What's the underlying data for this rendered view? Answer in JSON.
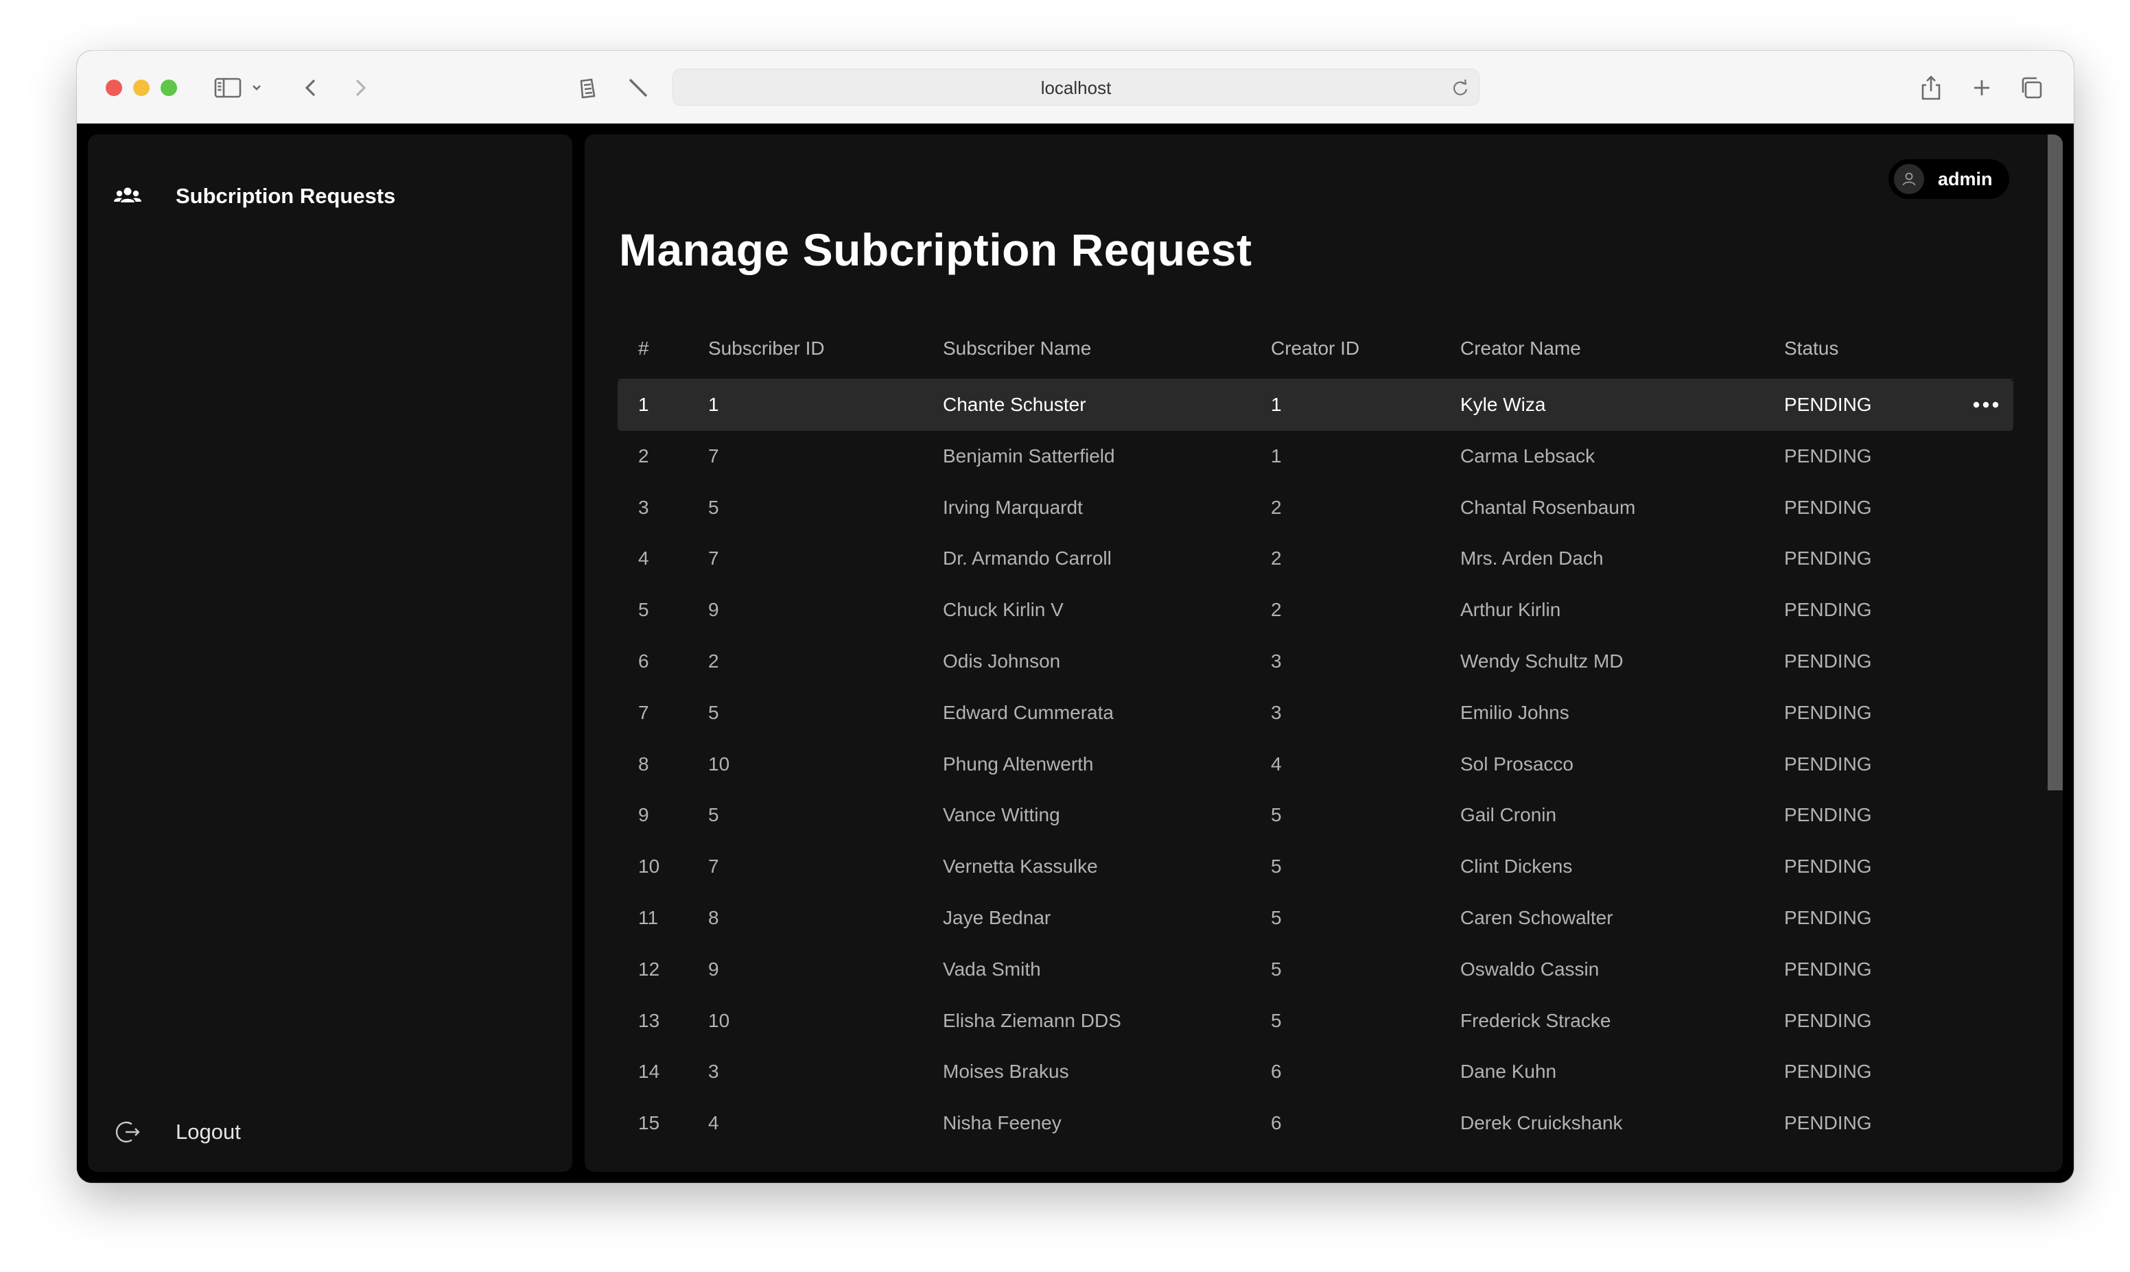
{
  "browser": {
    "url": "localhost"
  },
  "sidebar": {
    "items": [
      {
        "label": "Subcription Requests",
        "icon": "users-icon"
      }
    ],
    "logout_label": "Logout"
  },
  "header": {
    "user_name": "admin"
  },
  "main": {
    "title": "Manage Subcription Request",
    "columns": [
      "#",
      "Subscriber ID",
      "Subscriber Name",
      "Creator ID",
      "Creator Name",
      "Status"
    ],
    "rows": [
      {
        "num": "1",
        "subscriber_id": "1",
        "subscriber_name": "Chante Schuster",
        "creator_id": "1",
        "creator_name": "Kyle Wiza",
        "status": "PENDING"
      },
      {
        "num": "2",
        "subscriber_id": "7",
        "subscriber_name": "Benjamin Satterfield",
        "creator_id": "1",
        "creator_name": "Carma Lebsack",
        "status": "PENDING"
      },
      {
        "num": "3",
        "subscriber_id": "5",
        "subscriber_name": "Irving Marquardt",
        "creator_id": "2",
        "creator_name": "Chantal Rosenbaum",
        "status": "PENDING"
      },
      {
        "num": "4",
        "subscriber_id": "7",
        "subscriber_name": "Dr. Armando Carroll",
        "creator_id": "2",
        "creator_name": "Mrs. Arden Dach",
        "status": "PENDING"
      },
      {
        "num": "5",
        "subscriber_id": "9",
        "subscriber_name": "Chuck Kirlin V",
        "creator_id": "2",
        "creator_name": "Arthur Kirlin",
        "status": "PENDING"
      },
      {
        "num": "6",
        "subscriber_id": "2",
        "subscriber_name": "Odis Johnson",
        "creator_id": "3",
        "creator_name": "Wendy Schultz MD",
        "status": "PENDING"
      },
      {
        "num": "7",
        "subscriber_id": "5",
        "subscriber_name": "Edward Cummerata",
        "creator_id": "3",
        "creator_name": "Emilio Johns",
        "status": "PENDING"
      },
      {
        "num": "8",
        "subscriber_id": "10",
        "subscriber_name": "Phung Altenwerth",
        "creator_id": "4",
        "creator_name": "Sol Prosacco",
        "status": "PENDING"
      },
      {
        "num": "9",
        "subscriber_id": "5",
        "subscriber_name": "Vance Witting",
        "creator_id": "5",
        "creator_name": "Gail Cronin",
        "status": "PENDING"
      },
      {
        "num": "10",
        "subscriber_id": "7",
        "subscriber_name": "Vernetta Kassulke",
        "creator_id": "5",
        "creator_name": "Clint Dickens",
        "status": "PENDING"
      },
      {
        "num": "11",
        "subscriber_id": "8",
        "subscriber_name": "Jaye Bednar",
        "creator_id": "5",
        "creator_name": "Caren Schowalter",
        "status": "PENDING"
      },
      {
        "num": "12",
        "subscriber_id": "9",
        "subscriber_name": "Vada Smith",
        "creator_id": "5",
        "creator_name": "Oswaldo Cassin",
        "status": "PENDING"
      },
      {
        "num": "13",
        "subscriber_id": "10",
        "subscriber_name": "Elisha Ziemann DDS",
        "creator_id": "5",
        "creator_name": "Frederick Stracke",
        "status": "PENDING"
      },
      {
        "num": "14",
        "subscriber_id": "3",
        "subscriber_name": "Moises Brakus",
        "creator_id": "6",
        "creator_name": "Dane Kuhn",
        "status": "PENDING"
      },
      {
        "num": "15",
        "subscriber_id": "4",
        "subscriber_name": "Nisha Feeney",
        "creator_id": "6",
        "creator_name": "Derek Cruickshank",
        "status": "PENDING"
      }
    ],
    "highlighted_row": 0
  },
  "colors": {
    "background": "#000000",
    "panel": "#121212",
    "row_highlight": "#2a2a2a",
    "text_primary": "#ffffff",
    "text_secondary": "#b3b3b3"
  }
}
